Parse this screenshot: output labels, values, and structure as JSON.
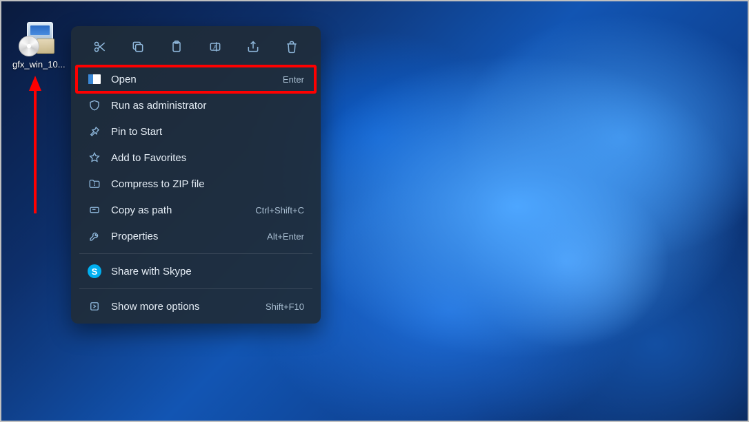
{
  "desktop": {
    "file_label": "gfx_win_10..."
  },
  "context_menu": {
    "items": [
      {
        "label": "Open",
        "shortcut": "Enter",
        "highlighted": true
      },
      {
        "label": "Run as administrator",
        "shortcut": ""
      },
      {
        "label": "Pin to Start",
        "shortcut": ""
      },
      {
        "label": "Add to Favorites",
        "shortcut": ""
      },
      {
        "label": "Compress to ZIP file",
        "shortcut": ""
      },
      {
        "label": "Copy as path",
        "shortcut": "Ctrl+Shift+C"
      },
      {
        "label": "Properties",
        "shortcut": "Alt+Enter"
      }
    ],
    "skype": {
      "label": "Share with Skype"
    },
    "more": {
      "label": "Show more options",
      "shortcut": "Shift+F10"
    }
  },
  "annotation": {
    "color": "#ff0000"
  }
}
